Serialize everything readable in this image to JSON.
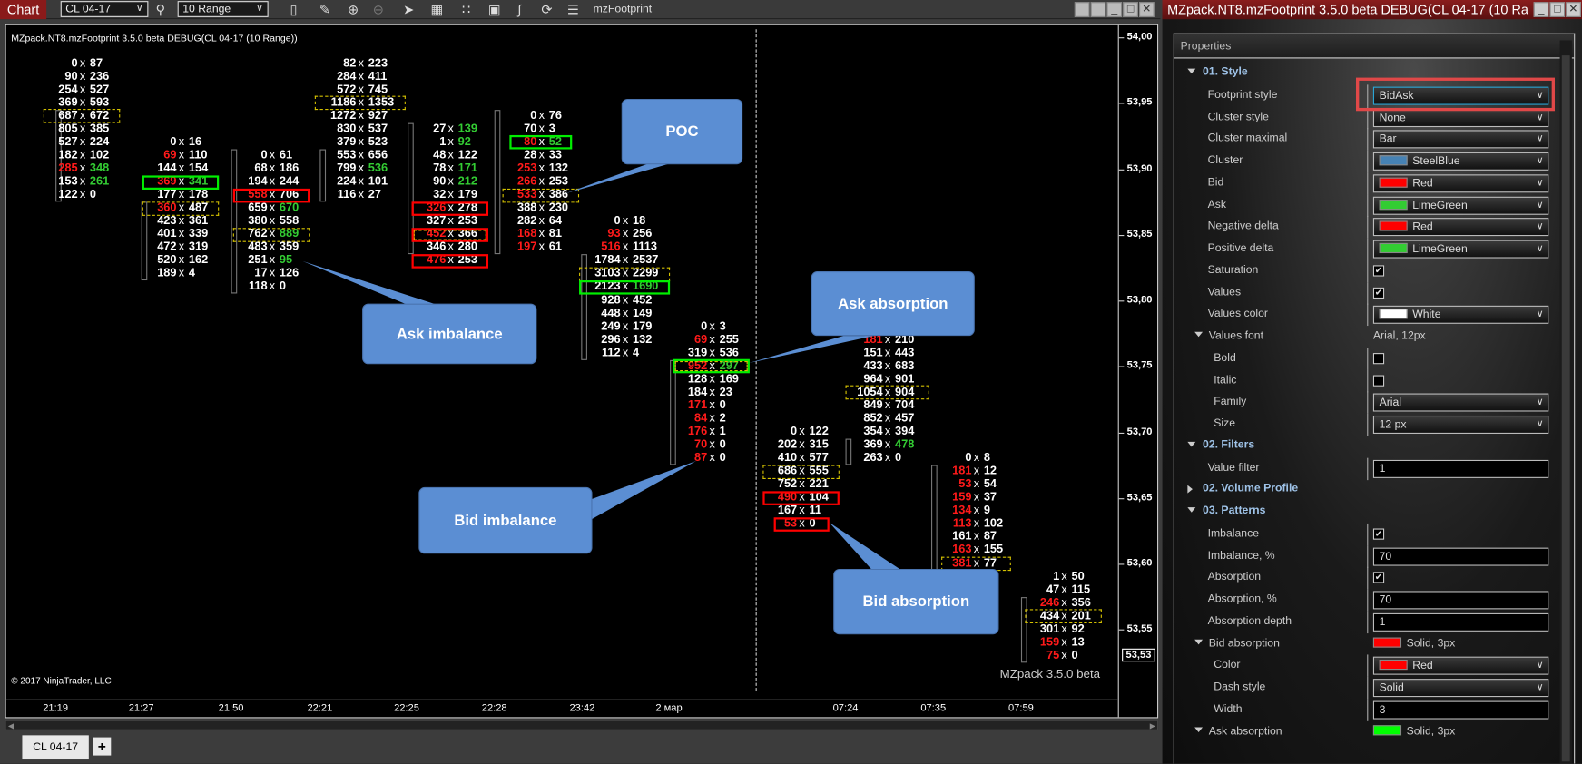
{
  "toolbar": {
    "chart_tab": "Chart",
    "instrument": "CL 04-17",
    "bar_type": "10 Range",
    "indicator_name": "mzFootprint",
    "icons": [
      "search-icon",
      "bar-style-icon",
      "pencil-icon",
      "zoom-in-icon",
      "zoom-out-icon",
      "pointer-icon",
      "data-box-icon",
      "indicators-icon",
      "strategies-icon",
      "drawing-tools-icon",
      "reload-icon",
      "properties-list-icon"
    ]
  },
  "chart": {
    "title": "MZpack.NT8.mzFootprint 3.5.0 beta DEBUG(CL 04-17 (10 Range))",
    "copyright": "© 2017 NinjaTrader, LLC",
    "watermark": "MZpack 3.5.0 beta",
    "price_ticks": [
      "54,00",
      "53,95",
      "53,90",
      "53,85",
      "53,80",
      "53,75",
      "53,70",
      "53,65",
      "53,60",
      "53,55"
    ],
    "price_values": [
      54.0,
      53.95,
      53.9,
      53.85,
      53.8,
      53.75,
      53.7,
      53.65,
      53.6,
      53.55
    ],
    "current_price_label": "53,53",
    "current_price": 53.53,
    "time_labels": [
      "21:19",
      "21:27",
      "21:50",
      "22:21",
      "22:25",
      "22:28",
      "23:42",
      "2 мар",
      "07:24",
      "07:35",
      "07:59"
    ],
    "colors": {
      "bid": "#ff1a1a",
      "ask": "#33cc33",
      "values": "#ffffff",
      "poc": "#d4c100",
      "imbalance_box_green": "#00ee00",
      "imbalance_box_red": "#ff0000",
      "callout": "#5b8ed3"
    },
    "callouts": [
      "POC",
      "Ask imbalance",
      "Ask absorption",
      "Bid imbalance",
      "Bid absorption"
    ],
    "columns": [
      {
        "top_price": 53.98,
        "body": [
          53.945,
          53.875
        ],
        "rows": [
          {
            "bid": "0",
            "ask": "87"
          },
          {
            "bid": "90",
            "ask": "236"
          },
          {
            "bid": "254",
            "ask": "527"
          },
          {
            "bid": "369",
            "ask": "593"
          },
          {
            "bid": "687",
            "ask": "672",
            "mark": "poc"
          },
          {
            "bid": "805",
            "ask": "385"
          },
          {
            "bid": "527",
            "ask": "224"
          },
          {
            "bid": "182",
            "ask": "102"
          },
          {
            "bid": "285",
            "ask": "348",
            "bid_color": "red",
            "ask_color": "green"
          },
          {
            "bid": "153",
            "ask": "261",
            "ask_color": "green"
          },
          {
            "bid": "122",
            "ask": "0"
          }
        ]
      },
      {
        "top_price": 53.92,
        "body": [
          53.875,
          53.815
        ],
        "rows": [
          {
            "bid": "0",
            "ask": "16"
          },
          {
            "bid": "69",
            "ask": "110",
            "bid_color": "red"
          },
          {
            "bid": "144",
            "ask": "154"
          },
          {
            "bid": "369",
            "ask": "341",
            "bid_color": "red",
            "ask_color": "green",
            "mark": "ask-imbalance"
          },
          {
            "bid": "177",
            "ask": "178"
          },
          {
            "bid": "360",
            "ask": "487",
            "bid_color": "red",
            "mark": "poc"
          },
          {
            "bid": "423",
            "ask": "361"
          },
          {
            "bid": "401",
            "ask": "339"
          },
          {
            "bid": "472",
            "ask": "319"
          },
          {
            "bid": "520",
            "ask": "162"
          },
          {
            "bid": "189",
            "ask": "4"
          }
        ]
      },
      {
        "top_price": 53.91,
        "body": [
          53.915,
          53.805
        ],
        "rows": [
          {
            "bid": "0",
            "ask": "61"
          },
          {
            "bid": "68",
            "ask": "186"
          },
          {
            "bid": "194",
            "ask": "244"
          },
          {
            "bid": "558",
            "ask": "706",
            "bid_color": "red",
            "mark": "bid-imbalance"
          },
          {
            "bid": "659",
            "ask": "670",
            "ask_color": "green"
          },
          {
            "bid": "380",
            "ask": "558"
          },
          {
            "bid": "762",
            "ask": "889",
            "ask_color": "green",
            "mark": "poc"
          },
          {
            "bid": "483",
            "ask": "359"
          },
          {
            "bid": "251",
            "ask": "95",
            "ask_color": "green"
          },
          {
            "bid": "17",
            "ask": "126"
          },
          {
            "bid": "118",
            "ask": "0"
          }
        ]
      },
      {
        "top_price": 53.98,
        "body": [
          53.915,
          53.875
        ],
        "rows": [
          {
            "bid": "82",
            "ask": "223"
          },
          {
            "bid": "284",
            "ask": "411"
          },
          {
            "bid": "572",
            "ask": "745"
          },
          {
            "bid": "1186",
            "ask": "1353",
            "mark": "poc"
          },
          {
            "bid": "1272",
            "ask": "927"
          },
          {
            "bid": "830",
            "ask": "537"
          },
          {
            "bid": "379",
            "ask": "523"
          },
          {
            "bid": "553",
            "ask": "656"
          },
          {
            "bid": "799",
            "ask": "536",
            "ask_color": "green"
          },
          {
            "bid": "224",
            "ask": "101"
          },
          {
            "bid": "116",
            "ask": "27"
          }
        ]
      },
      {
        "top_price": 53.93,
        "body": [
          53.935,
          53.835
        ],
        "rows": [
          {
            "bid": "27",
            "ask": "139",
            "ask_color": "green"
          },
          {
            "bid": "1",
            "ask": "92",
            "ask_color": "green"
          },
          {
            "bid": "48",
            "ask": "122"
          },
          {
            "bid": "78",
            "ask": "171",
            "ask_color": "green"
          },
          {
            "bid": "90",
            "ask": "212",
            "ask_color": "green"
          },
          {
            "bid": "32",
            "ask": "179"
          },
          {
            "bid": "326",
            "ask": "278",
            "bid_color": "red",
            "mark": "bid-imbalance"
          },
          {
            "bid": "327",
            "ask": "253"
          },
          {
            "bid": "452",
            "ask": "366",
            "bid_color": "red",
            "mark": "bid-imbalance-poc"
          },
          {
            "bid": "346",
            "ask": "280"
          },
          {
            "bid": "476",
            "ask": "253",
            "bid_color": "red",
            "mark": "bid-imbalance"
          }
        ]
      },
      {
        "top_price": 53.94,
        "body": [
          53.945,
          53.835
        ],
        "rows": [
          {
            "bid": "0",
            "ask": "76"
          },
          {
            "bid": "70",
            "ask": "3"
          },
          {
            "bid": "80",
            "ask": "52",
            "bid_color": "red",
            "ask_color": "green",
            "mark": "ask-imbalance"
          },
          {
            "bid": "28",
            "ask": "33"
          },
          {
            "bid": "253",
            "ask": "132",
            "bid_color": "red"
          },
          {
            "bid": "266",
            "ask": "253",
            "bid_color": "red"
          },
          {
            "bid": "533",
            "ask": "386",
            "bid_color": "red",
            "mark": "poc"
          },
          {
            "bid": "388",
            "ask": "230"
          },
          {
            "bid": "282",
            "ask": "64"
          },
          {
            "bid": "168",
            "ask": "81",
            "bid_color": "red"
          },
          {
            "bid": "197",
            "ask": "61",
            "bid_color": "red"
          }
        ]
      },
      {
        "top_price": 53.86,
        "body": [
          53.835,
          53.755
        ],
        "rows": [
          {
            "bid": "0",
            "ask": "18"
          },
          {
            "bid": "93",
            "ask": "256",
            "bid_color": "red"
          },
          {
            "bid": "516",
            "ask": "1113",
            "bid_color": "red"
          },
          {
            "bid": "1784",
            "ask": "2537"
          },
          {
            "bid": "3103",
            "ask": "2299",
            "mark": "poc"
          },
          {
            "bid": "2123",
            "ask": "1690",
            "ask_color": "green",
            "mark": "ask-imbalance"
          },
          {
            "bid": "928",
            "ask": "452"
          },
          {
            "bid": "448",
            "ask": "149"
          },
          {
            "bid": "249",
            "ask": "179"
          },
          {
            "bid": "296",
            "ask": "132"
          },
          {
            "bid": "112",
            "ask": "4"
          }
        ]
      },
      {
        "top_price": 53.78,
        "body": [
          53.755,
          53.675
        ],
        "rows": [
          {
            "bid": "0",
            "ask": "3"
          },
          {
            "bid": "69",
            "ask": "255",
            "bid_color": "red"
          },
          {
            "bid": "319",
            "ask": "536"
          },
          {
            "bid": "952",
            "ask": "297",
            "bid_color": "red",
            "ask_color": "green",
            "mark": "ask-absorption-poc"
          },
          {
            "bid": "128",
            "ask": "169"
          },
          {
            "bid": "184",
            "ask": "23"
          },
          {
            "bid": "171",
            "ask": "0",
            "bid_color": "red"
          },
          {
            "bid": "84",
            "ask": "2",
            "bid_color": "red"
          },
          {
            "bid": "176",
            "ask": "1",
            "bid_color": "red"
          },
          {
            "bid": "70",
            "ask": "0",
            "bid_color": "red"
          },
          {
            "bid": "87",
            "ask": "0",
            "bid_color": "red"
          }
        ]
      },
      {
        "top_price": 53.7,
        "rows": [
          {
            "bid": "0",
            "ask": "122"
          },
          {
            "bid": "202",
            "ask": "315"
          },
          {
            "bid": "410",
            "ask": "577"
          },
          {
            "bid": "686",
            "ask": "555",
            "mark": "poc"
          },
          {
            "bid": "752",
            "ask": "221"
          },
          {
            "bid": "490",
            "ask": "104",
            "bid_color": "red",
            "mark": "bid-imbalance"
          },
          {
            "bid": "167",
            "ask": "11"
          },
          {
            "bid": "53",
            "ask": "0",
            "bid_color": "red",
            "mark": "bid-imbalance"
          }
        ]
      },
      {
        "top_price": 53.77,
        "body": [
          53.695,
          53.675
        ],
        "rows": [
          {
            "bid": "181",
            "ask": "210",
            "bid_color": "red"
          },
          {
            "bid": "151",
            "ask": "443"
          },
          {
            "bid": "433",
            "ask": "683"
          },
          {
            "bid": "964",
            "ask": "901"
          },
          {
            "bid": "1054",
            "ask": "904",
            "mark": "poc"
          },
          {
            "bid": "849",
            "ask": "704"
          },
          {
            "bid": "852",
            "ask": "457"
          },
          {
            "bid": "354",
            "ask": "394"
          },
          {
            "bid": "369",
            "ask": "478",
            "ask_color": "green"
          },
          {
            "bid": "263",
            "ask": "0"
          }
        ]
      },
      {
        "top_price": 53.68,
        "body": [
          53.675,
          53.56
        ],
        "rows": [
          {
            "bid": "0",
            "ask": "8"
          },
          {
            "bid": "181",
            "ask": "12",
            "bid_color": "red"
          },
          {
            "bid": "53",
            "ask": "54",
            "bid_color": "red"
          },
          {
            "bid": "159",
            "ask": "37",
            "bid_color": "red"
          },
          {
            "bid": "134",
            "ask": "9",
            "bid_color": "red"
          },
          {
            "bid": "113",
            "ask": "102",
            "bid_color": "red"
          },
          {
            "bid": "161",
            "ask": "87"
          },
          {
            "bid": "163",
            "ask": "155",
            "bid_color": "red"
          },
          {
            "bid": "381",
            "ask": "77",
            "bid_color": "red",
            "mark": "poc"
          }
        ]
      },
      {
        "top_price": 53.59,
        "body": [
          53.575,
          53.525
        ],
        "rows": [
          {
            "bid": "1",
            "ask": "50"
          },
          {
            "bid": "47",
            "ask": "115"
          },
          {
            "bid": "246",
            "ask": "356",
            "bid_color": "red"
          },
          {
            "bid": "434",
            "ask": "201",
            "mark": "poc"
          },
          {
            "bid": "301",
            "ask": "92"
          },
          {
            "bid": "159",
            "ask": "13",
            "bid_color": "red"
          },
          {
            "bid": "75",
            "ask": "0",
            "bid_color": "red"
          }
        ]
      }
    ]
  },
  "bottom": {
    "tab": "CL 04-17",
    "add_tab": "+"
  },
  "panel": {
    "title": "MZpack.NT8.mzFootprint 3.5.0 beta DEBUG(CL 04-17 (10 Ra",
    "header": "Properties",
    "rows": [
      {
        "type": "section",
        "label": "01. Style",
        "expanded": true
      },
      {
        "type": "dropdown",
        "label": "Footprint style",
        "value": "BidAsk",
        "highlighted": true
      },
      {
        "type": "dropdown",
        "label": "Cluster style",
        "value": "None"
      },
      {
        "type": "dropdown",
        "label": "Cluster maximal",
        "value": "Bar"
      },
      {
        "type": "color",
        "label": "Cluster",
        "value": "SteelBlue",
        "color": "#4682b4"
      },
      {
        "type": "color",
        "label": "Bid",
        "value": "Red",
        "color": "#ff0000"
      },
      {
        "type": "color",
        "label": "Ask",
        "value": "LimeGreen",
        "color": "#32cd32"
      },
      {
        "type": "color",
        "label": "Negative delta",
        "value": "Red",
        "color": "#ff0000"
      },
      {
        "type": "color",
        "label": "Positive delta",
        "value": "LimeGreen",
        "color": "#32cd32"
      },
      {
        "type": "check",
        "label": "Saturation",
        "checked": true
      },
      {
        "type": "check",
        "label": "Values",
        "checked": true
      },
      {
        "type": "color",
        "label": "Values color",
        "value": "White",
        "color": "#ffffff"
      },
      {
        "type": "group",
        "label": "Values font",
        "value": "Arial, 12px"
      },
      {
        "type": "check",
        "label": "Bold",
        "checked": false,
        "sub": true
      },
      {
        "type": "check",
        "label": "Italic",
        "checked": false,
        "sub": true
      },
      {
        "type": "dropdown",
        "label": "Family",
        "value": "Arial",
        "sub": true
      },
      {
        "type": "dropdown",
        "label": "Size",
        "value": "12 px",
        "sub": true
      },
      {
        "type": "section",
        "label": "02. Filters",
        "expanded": true
      },
      {
        "type": "input",
        "label": "Value filter",
        "value": "1"
      },
      {
        "type": "section",
        "label": "02. Volume Profile",
        "expanded": false
      },
      {
        "type": "section",
        "label": "03. Patterns",
        "expanded": true
      },
      {
        "type": "check",
        "label": "Imbalance",
        "checked": true
      },
      {
        "type": "input",
        "label": "Imbalance, %",
        "value": "70"
      },
      {
        "type": "check",
        "label": "Absorption",
        "checked": true
      },
      {
        "type": "input",
        "label": "Absorption, %",
        "value": "70"
      },
      {
        "type": "input",
        "label": "Absorption depth",
        "value": "1"
      },
      {
        "type": "group",
        "label": "Bid absorption",
        "value": "Solid, 3px",
        "color": "#ff0000"
      },
      {
        "type": "color",
        "label": "Color",
        "value": "Red",
        "color": "#ff0000",
        "sub": true
      },
      {
        "type": "dropdown",
        "label": "Dash style",
        "value": "Solid",
        "sub": true
      },
      {
        "type": "input",
        "label": "Width",
        "value": "3",
        "sub": true
      },
      {
        "type": "group",
        "label": "Ask absorption",
        "value": "Solid, 3px",
        "color": "#00ff00"
      }
    ]
  }
}
